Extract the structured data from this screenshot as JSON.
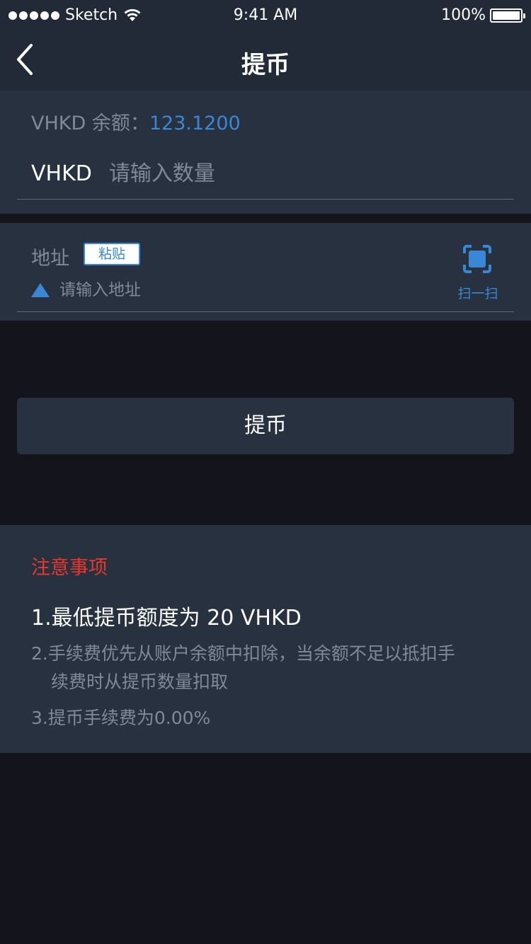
{
  "status_bar": {
    "carrier": "Sketch",
    "time": "9:41 AM",
    "battery": "100%"
  },
  "nav": {
    "title": "提币",
    "back_icon": "chevron-left-icon"
  },
  "balance": {
    "label": "VHKD 余额：",
    "value": "123.1200"
  },
  "amount": {
    "currency": "VHKD",
    "placeholder": "请输入数量",
    "value": ""
  },
  "address": {
    "label": "地址",
    "paste_label": "粘贴",
    "placeholder": "请输入地址",
    "value": "",
    "scan_label": "扫一扫",
    "scan_icon": "scan-icon"
  },
  "submit": {
    "label": "提币"
  },
  "notes": {
    "title": "注意事项",
    "item1": "1.最低提币额度为 20 VHKD",
    "item2_line1": "2.手续费优先从账户余额中扣除，当余额不足以抵扣手",
    "item2_line2": "续费时从提币数量扣取",
    "item3": "3.提币手续费为0.00%"
  },
  "colors": {
    "accent": "#3a87d5",
    "warning": "#e8372b",
    "panel": "#28313f",
    "background": "#13141c"
  }
}
